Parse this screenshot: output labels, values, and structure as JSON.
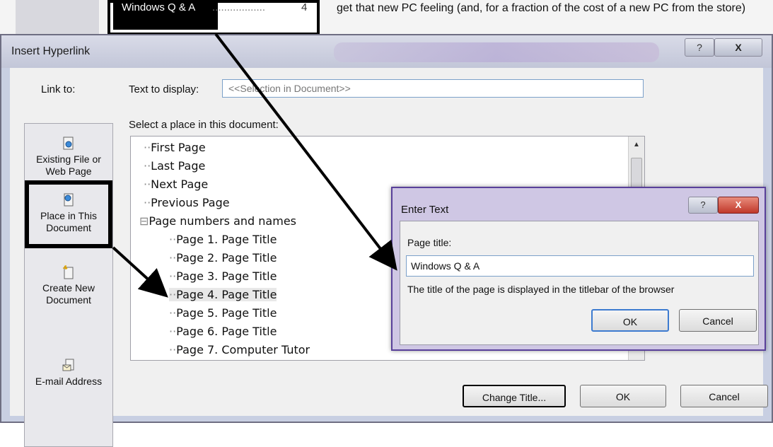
{
  "document": {
    "toc_entry": "Windows Q & A",
    "toc_dots": "..................",
    "toc_page": "4",
    "body_text": "get that new PC feeling (and, for a fraction of the cost of a new PC from the store)"
  },
  "main_dialog": {
    "title": "Insert Hyperlink",
    "help_icon": "?",
    "close_icon": "X",
    "link_to_label": "Link to:",
    "link_items": [
      {
        "label": "Existing File or Web Page",
        "icon": "file-web-icon"
      },
      {
        "label": "Place in This Document",
        "icon": "document-place-icon"
      },
      {
        "label": "Create New Document",
        "icon": "new-document-icon"
      },
      {
        "label": "E-mail Address",
        "icon": "email-icon"
      }
    ],
    "text_display_label": "Text to display:",
    "text_display_value": "<<Selection in Document>>",
    "select_place_label": "Select a place in this document:",
    "tree": [
      "First Page",
      "Last Page",
      "Next Page",
      "Previous Page",
      "Page numbers and names",
      "Page 1. Page Title",
      "Page 2. Page Title",
      "Page 3. Page Title",
      "Page 4. Page Title",
      "Page 5. Page Title",
      "Page 6. Page Title",
      "Page 7. Computer Tutor"
    ],
    "tree_expand": "⊟",
    "change_title_label": "Change Title...",
    "ok_label": "OK",
    "cancel_label": "Cancel"
  },
  "enter_dialog": {
    "title": "Enter Text",
    "help_icon": "?",
    "close_icon": "X",
    "page_title_label": "Page title:",
    "page_title_value": "Windows Q & A",
    "hint": "The title of the page is displayed in the titlebar of the browser",
    "ok_label": "OK",
    "cancel_label": "Cancel"
  }
}
